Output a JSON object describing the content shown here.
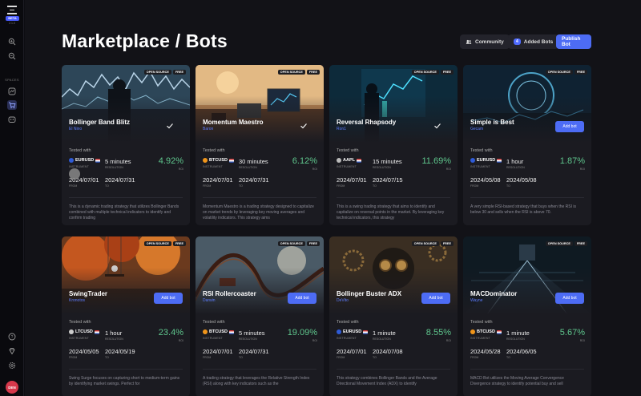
{
  "sidebar": {
    "logo_badge": "BETA",
    "logo_sub": "2.1.0",
    "section_label": "SPACES",
    "avatar": "DEN"
  },
  "header": {
    "title": "Marketplace / Bots",
    "community_label": "Community",
    "added_count": "4",
    "added_label": "Added Bots",
    "publish_label": "Publish Bot"
  },
  "labels": {
    "open_source": "OPEN SOURCE",
    "free": "FREE",
    "add_bot": "Add bot",
    "tested_with": "Tested with",
    "instrument": "INSTRUMENT",
    "resolution": "RESOLUTION",
    "roi": "ROI",
    "from": "FROM",
    "to": "TO"
  },
  "cards": [
    {
      "name": "Bollinger Band Blitz",
      "author": "El Nino",
      "added": true,
      "instrument": "EURUSD",
      "coin": "#2f5bd6",
      "resolution": "5 minutes",
      "roi": "4.92%",
      "from": "2024/07/01",
      "to": "2024/07/31",
      "desc": "This is a dynamic trading strategy that utilizes Bollinger Bands combined with multiple technical indicators to identify and confirm trading",
      "theme": "market"
    },
    {
      "name": "Momentum Maestro",
      "author": "Baron",
      "added": true,
      "instrument": "BTCUSD",
      "coin": "#f0951a",
      "resolution": "30 minutes",
      "roi": "6.12%",
      "from": "2024/07/01",
      "to": "2024/07/31",
      "desc": "Momentum Maestro is a trading strategy designed to capitalize on market trends by leveraging key moving averages and volatility indicators. This strategy aims",
      "theme": "desk"
    },
    {
      "name": "Reversal Rhapsody",
      "author": "Ron1",
      "added": true,
      "instrument": "AAPL",
      "coin": "#bbbbbb",
      "resolution": "15 minutes",
      "roi": "11.69%",
      "from": "2024/07/01",
      "to": "2024/07/15",
      "desc": "This is a swing trading strategy that aims to identify and capitalize on reversal points in the market. By leveraging key technical indicators, this strategy",
      "theme": "hologram"
    },
    {
      "name": "Simple is Best",
      "author": "Gecam",
      "added": false,
      "instrument": "EURUSD",
      "coin": "#2f5bd6",
      "resolution": "1 hour",
      "roi": "1.87%",
      "from": "2024/05/08",
      "to": "2024/05/08",
      "desc": "A very simple RSI-based strategy that buys when the RSI is below 30 and sells when the RSI is above 70.",
      "theme": "circle"
    },
    {
      "name": "SwingTrader",
      "author": "Kronotos",
      "added": false,
      "instrument": "LTCUSD",
      "coin": "#cccccc",
      "resolution": "1 hour",
      "roi": "23.4%",
      "from": "2024/05/05",
      "to": "2024/05/19",
      "desc": "Swing Surge focuses on capturing short to medium-term gains by identifying market swings. Perfect for",
      "theme": "autumn"
    },
    {
      "name": "RSI Rollercoaster",
      "author": "Darwin",
      "added": false,
      "instrument": "BTCUSD",
      "coin": "#f0951a",
      "resolution": "5 minutes",
      "roi": "19.09%",
      "from": "2024/07/01",
      "to": "2024/07/31",
      "desc": "A trading strategy that leverages the Relative Strength Index (RSI) along with key indicators such as the",
      "theme": "coaster"
    },
    {
      "name": "Bollinger Buster ADX",
      "author": "DeVito",
      "added": false,
      "instrument": "EURUSD",
      "coin": "#2f5bd6",
      "resolution": "1 minute",
      "roi": "8.55%",
      "from": "2024/07/01",
      "to": "2024/07/08",
      "desc": "This strategy combines Bollinger Bands and the Average Directional Movement Index (ADX) to identify",
      "theme": "steampunk"
    },
    {
      "name": "MACDominator",
      "author": "Wayne",
      "added": false,
      "instrument": "BTCUSD",
      "coin": "#f0951a",
      "resolution": "1 minute",
      "roi": "5.67%",
      "from": "2024/05/28",
      "to": "2024/06/05",
      "desc": "MACD Bot utilizes the Moving Average Convergence Divergence strategy to identify potential buy and sell",
      "theme": "rails"
    }
  ]
}
